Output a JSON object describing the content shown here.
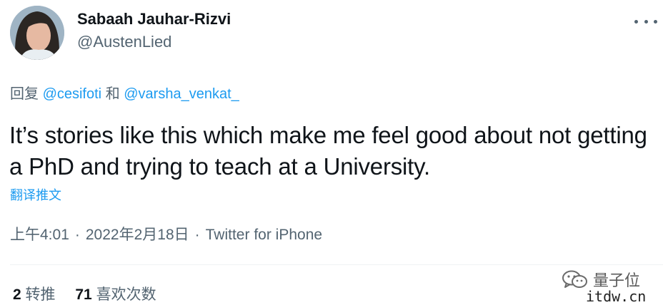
{
  "author": {
    "name": "Sabaah Jauhar-Rizvi",
    "handle": "@AustenLied"
  },
  "reply": {
    "prefix": "回复",
    "mention1": "@cesifoti",
    "conjunction": "和",
    "mention2": "@varsha_venkat_"
  },
  "tweet": {
    "text": "It’s stories like this which make me feel good about not getting a PhD and trying to teach at a University.",
    "translate_label": "翻译推文"
  },
  "meta": {
    "time": "上午4:01",
    "date": "2022年2月18日",
    "source": "Twitter for iPhone",
    "separator": "·"
  },
  "stats": {
    "retweets_count": "2",
    "retweets_label": "转推",
    "likes_count": "71",
    "likes_label": "喜欢次数"
  },
  "watermark": {
    "brand": "量子位",
    "site": "itdw.cn"
  },
  "icons": {
    "more": "more-horizontal-icon",
    "wechat": "wechat-icon"
  },
  "colors": {
    "link": "#1d9bf0",
    "secondary": "#536471",
    "primary": "#0f1419"
  }
}
